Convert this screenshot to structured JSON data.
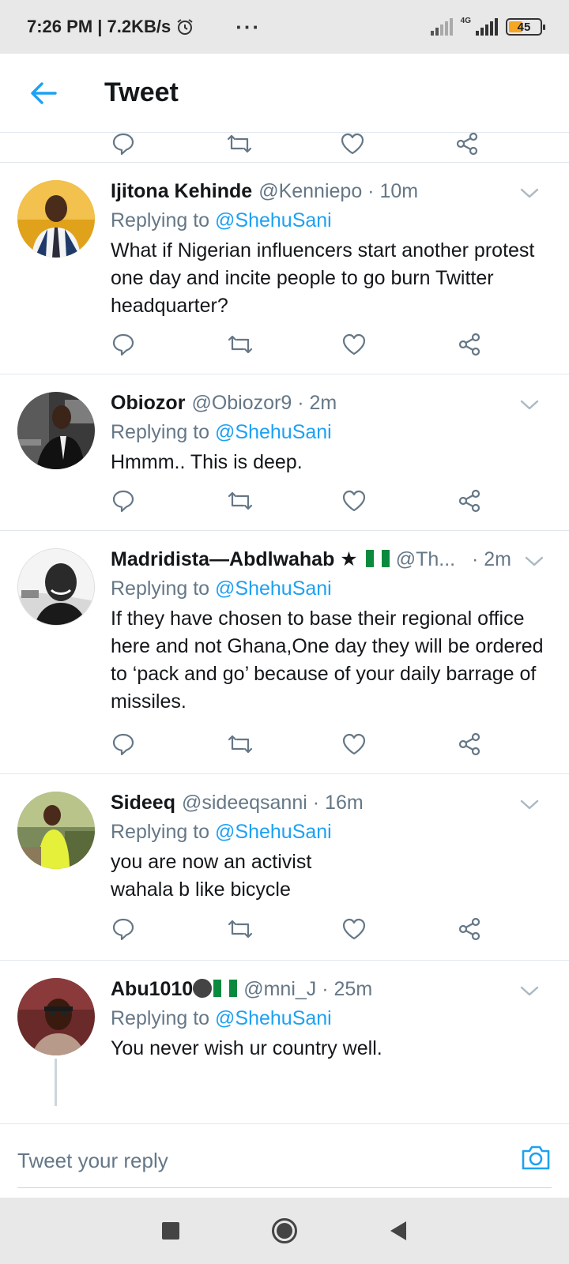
{
  "status_bar": {
    "time_speed": "7:26 PM | 7.2KB/s",
    "more": "···",
    "network": "4G",
    "battery": "45",
    "battery_level": 0.45
  },
  "header": {
    "title": "Tweet",
    "back_icon": "arrow-left-icon"
  },
  "colors": {
    "accent": "#1da1f2",
    "secondary_text": "#657786",
    "primary_text": "#14171a",
    "divider": "#e1e8ed"
  },
  "actions": {
    "reply_icon": "reply-icon",
    "retweet_icon": "retweet-icon",
    "like_icon": "heart-icon",
    "share_icon": "share-icon"
  },
  "tweets": [
    {
      "name": "Ijitona Kehinde",
      "handle": "@Kenniepo",
      "time": "· 10m",
      "replying_prefix": "Replying to",
      "replying_to": "@ShehuSani",
      "text": "What if Nigerian influencers start another protest one day and incite  people to go burn Twitter headquarter?"
    },
    {
      "name": "Obiozor",
      "handle": "@Obiozor9",
      "time": "· 2m",
      "replying_prefix": "Replying to",
      "replying_to": "@ShehuSani",
      "text": "Hmmm.. This is deep."
    },
    {
      "name": "Madridista—Abdlwahab ★",
      "handle": "@Th...",
      "time": "· 2m",
      "replying_prefix": "Replying to",
      "replying_to": "@ShehuSani",
      "text": "If they have chosen to base their regional office here and not Ghana,One day they will be ordered to ‘pack and go’ because of your daily barrage of missiles."
    },
    {
      "name": "Sideeq",
      "handle": "@sideeqsanni",
      "time": "· 16m",
      "replying_prefix": "Replying to",
      "replying_to": "@ShehuSani",
      "text": "you are now an activist\nwahala b like bicycle"
    },
    {
      "name": "Abu1010",
      "handle": "@mni_J",
      "time": "· 25m",
      "replying_prefix": "Replying to",
      "replying_to": "@ShehuSani",
      "text": "You never wish ur country well."
    }
  ],
  "reply_bar": {
    "placeholder": "Tweet your reply",
    "camera_icon": "camera-icon"
  },
  "nav_bar": {
    "recents_icon": "square-icon",
    "home_icon": "circle-icon",
    "back_icon": "triangle-back-icon"
  }
}
